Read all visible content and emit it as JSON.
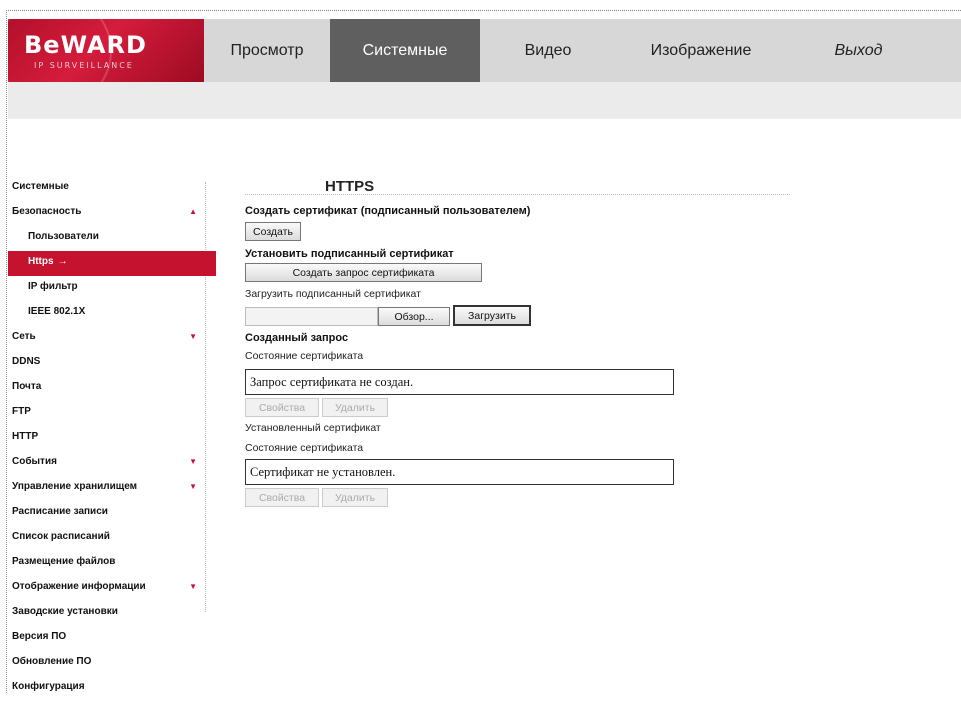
{
  "header": {
    "logo_text": "BeWARD",
    "logo_sub": "IP SURVEILLANCE",
    "nav": [
      {
        "label": "Просмотр",
        "active": false
      },
      {
        "label": "Системные",
        "active": true
      },
      {
        "label": "Видео",
        "active": false
      },
      {
        "label": "Изображение",
        "active": false
      },
      {
        "label": "Выход",
        "active": false
      }
    ]
  },
  "sidebar": {
    "items": [
      {
        "label": "Системные"
      },
      {
        "label": "Безопасность",
        "arrow": "up"
      },
      {
        "label": "Пользователи",
        "sub": true
      },
      {
        "label": "Https",
        "sub": true,
        "active": true
      },
      {
        "label": "IP фильтр",
        "sub": true
      },
      {
        "label": "IEEE 802.1X",
        "sub": true
      },
      {
        "label": "Сеть",
        "arrow": "down"
      },
      {
        "label": "DDNS"
      },
      {
        "label": "Почта"
      },
      {
        "label": "FTP"
      },
      {
        "label": "HTTP"
      },
      {
        "label": "События",
        "arrow": "down"
      },
      {
        "label": "Управление хранилищем",
        "arrow": "down"
      },
      {
        "label": "Расписание записи"
      },
      {
        "label": "Список расписаний"
      },
      {
        "label": "Размещение файлов"
      },
      {
        "label": "Отображение информации",
        "arrow": "down"
      },
      {
        "label": "Заводские установки"
      },
      {
        "label": "Версия ПО"
      },
      {
        "label": "Обновление ПО"
      },
      {
        "label": "Конфигурация"
      }
    ],
    "active_marker": "→",
    "arrow_up": "▲",
    "arrow_down": "▼"
  },
  "content": {
    "title": "HTTPS",
    "create_section": "Создать сертификат (подписанный пользователем)",
    "create_button": "Создать",
    "install_section": "Установить подписанный сертификат",
    "request_button": "Создать запрос сертификата",
    "upload_label": "Загрузить подписанный сертификат",
    "browse_button": "Обзор...",
    "upload_button": "Загрузить",
    "created_request_section": "Созданный запрос",
    "cert_status_label_1": "Состояние сертификата",
    "request_status": "Запрос сертификата не создан.",
    "properties_button_1": "Свойства",
    "delete_button_1": "Удалить",
    "installed_cert_label": "Установленный сертификат",
    "cert_status_label_2": "Состояние сертификата",
    "installed_status": "Сертификат не установлен.",
    "properties_button_2": "Свойства",
    "delete_button_2": "Удалить"
  }
}
